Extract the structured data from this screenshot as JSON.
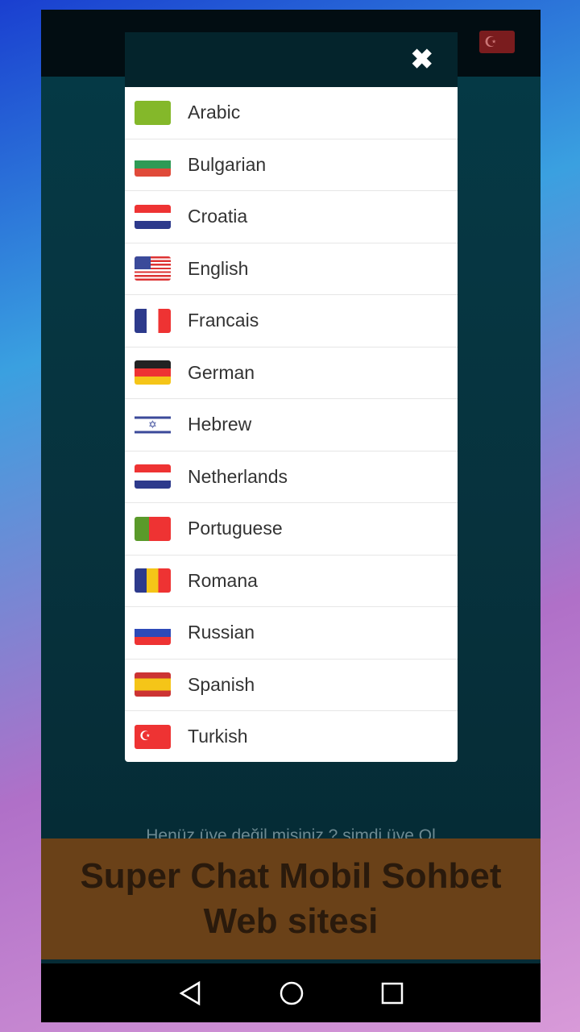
{
  "app": {
    "signup_text": "Henüz üye değil misiniz ? şimdi üye Ol",
    "banner_title": "Super Chat Mobil Sohbet Web sitesi",
    "header_flag_icon": "turkey-flag-icon"
  },
  "modal": {
    "close_icon": "close-icon",
    "languages": [
      {
        "label": "Arabic",
        "flag": "sa"
      },
      {
        "label": "Bulgarian",
        "flag": "bg"
      },
      {
        "label": "Croatia",
        "flag": "hr"
      },
      {
        "label": "English",
        "flag": "us"
      },
      {
        "label": "Francais",
        "flag": "fr"
      },
      {
        "label": "German",
        "flag": "de"
      },
      {
        "label": "Hebrew",
        "flag": "il"
      },
      {
        "label": "Netherlands",
        "flag": "nl"
      },
      {
        "label": "Portuguese",
        "flag": "pt"
      },
      {
        "label": "Romana",
        "flag": "ro"
      },
      {
        "label": "Russian",
        "flag": "ru"
      },
      {
        "label": "Spanish",
        "flag": "es"
      },
      {
        "label": "Turkish",
        "flag": "tr"
      }
    ]
  },
  "nav": {
    "back_icon": "back-icon",
    "home_icon": "home-icon",
    "recents_icon": "recents-icon"
  }
}
